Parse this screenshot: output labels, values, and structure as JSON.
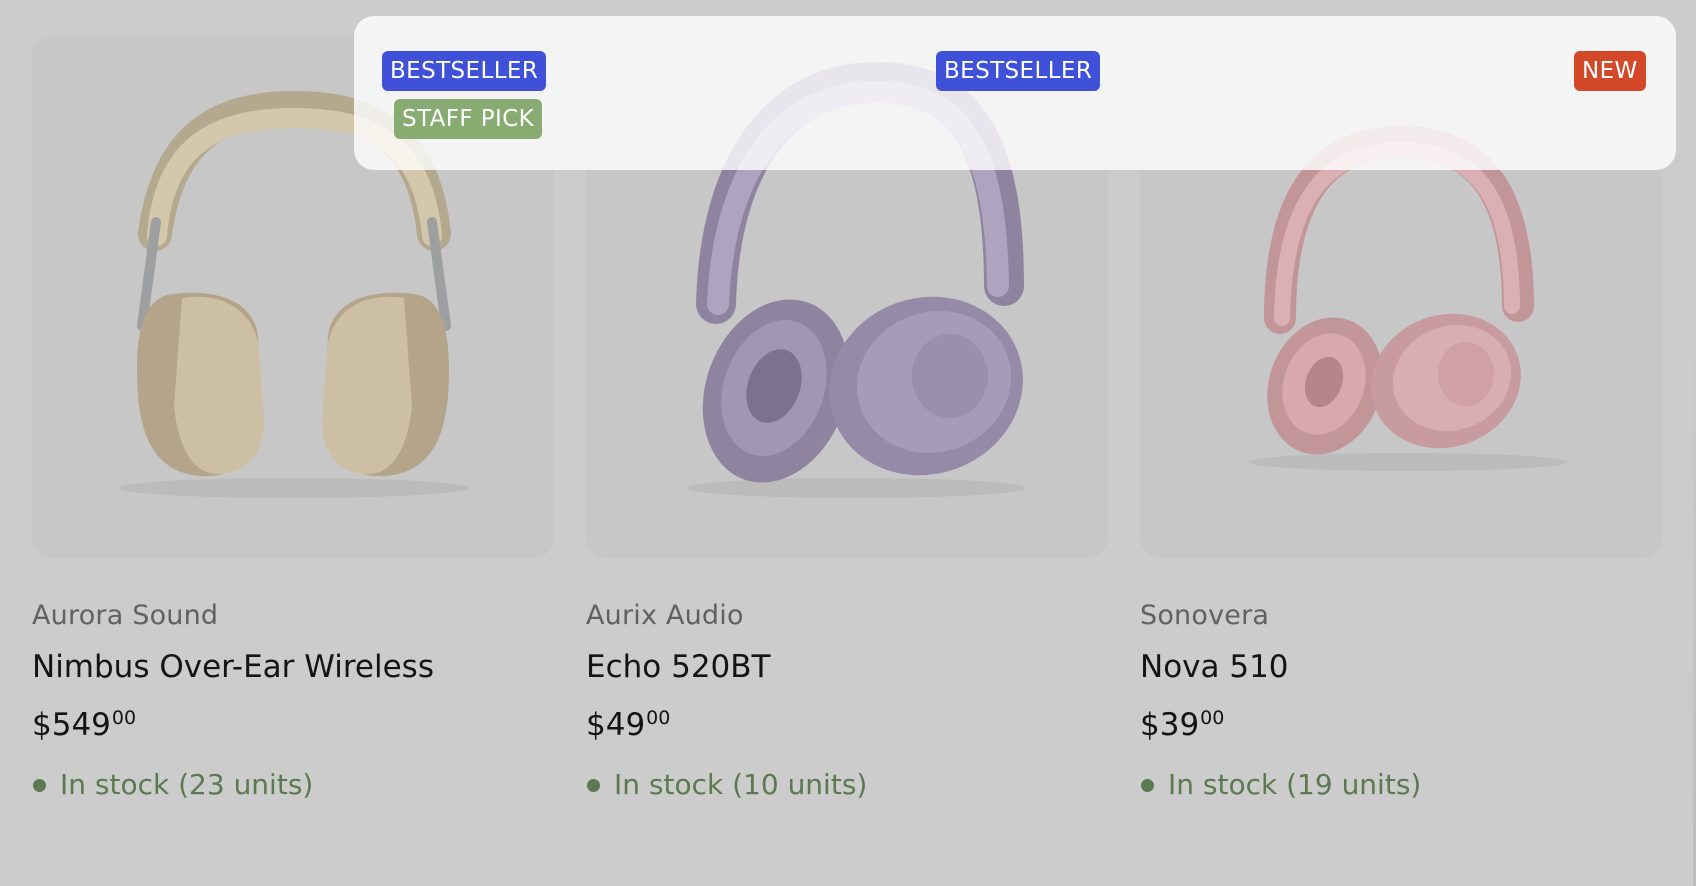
{
  "products": [
    {
      "brand": "Aurora Sound",
      "name": "Nimbus Over-Ear Wireless",
      "price_dollars": "$549",
      "price_cents": "00",
      "stock": "In stock (23 units)",
      "badges": [
        "BESTSELLER",
        "STAFF PICK"
      ],
      "color": "#cbbda0"
    },
    {
      "brand": "Aurix Audio",
      "name": "Echo 520BT",
      "price_dollars": "$49",
      "price_cents": "00",
      "stock": "In stock (10 units)",
      "badges": [
        "BESTSELLER"
      ],
      "color": "#a196b4"
    },
    {
      "brand": "Sonovera",
      "name": "Nova 510",
      "price_dollars": "$39",
      "price_cents": "00",
      "stock": "In stock (19 units)",
      "badges": [
        "NEW"
      ],
      "color": "#d7a9ad"
    }
  ],
  "colors": {
    "background": "#cccccc",
    "badge_bestseller": "#3f51d8",
    "badge_staff_pick": "#88ab72",
    "badge_new": "#d4482a",
    "stock_green": "#5c7a4f"
  }
}
